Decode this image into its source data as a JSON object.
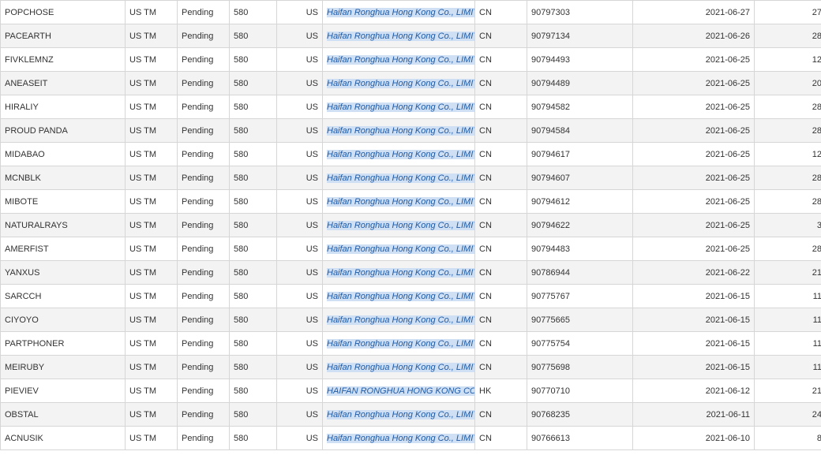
{
  "rows": [
    {
      "name": "POPCHOSE",
      "office": "US TM",
      "status": "Pending",
      "code": "580",
      "country": "US",
      "owner": "Haifan Ronghua Hong Kong Co., LIMITED",
      "owner_country": "CN",
      "serial": "90797303",
      "date": "2021-06-27",
      "count": "27"
    },
    {
      "name": "PACEARTH",
      "office": "US TM",
      "status": "Pending",
      "code": "580",
      "country": "US",
      "owner": "Haifan Ronghua Hong Kong Co., LIMITED",
      "owner_country": "CN",
      "serial": "90797134",
      "date": "2021-06-26",
      "count": "28"
    },
    {
      "name": "FIVKLEMNZ",
      "office": "US TM",
      "status": "Pending",
      "code": "580",
      "country": "US",
      "owner": "Haifan Ronghua Hong Kong Co., LIMITED",
      "owner_country": "CN",
      "serial": "90794493",
      "date": "2021-06-25",
      "count": "12"
    },
    {
      "name": "ANEASEIT",
      "office": "US TM",
      "status": "Pending",
      "code": "580",
      "country": "US",
      "owner": "Haifan Ronghua Hong Kong Co., LIMITED",
      "owner_country": "CN",
      "serial": "90794489",
      "date": "2021-06-25",
      "count": "20"
    },
    {
      "name": "HIRALIY",
      "office": "US TM",
      "status": "Pending",
      "code": "580",
      "country": "US",
      "owner": "Haifan Ronghua Hong Kong Co., LIMITED",
      "owner_country": "CN",
      "serial": "90794582",
      "date": "2021-06-25",
      "count": "28"
    },
    {
      "name": "PROUD PANDA",
      "office": "US TM",
      "status": "Pending",
      "code": "580",
      "country": "US",
      "owner": "Haifan Ronghua Hong Kong Co., LIMITED",
      "owner_country": "CN",
      "serial": "90794584",
      "date": "2021-06-25",
      "count": "28"
    },
    {
      "name": "MIDABAO",
      "office": "US TM",
      "status": "Pending",
      "code": "580",
      "country": "US",
      "owner": "Haifan Ronghua Hong Kong Co., LIMITED",
      "owner_country": "CN",
      "serial": "90794617",
      "date": "2021-06-25",
      "count": "12"
    },
    {
      "name": "MCNBLK",
      "office": "US TM",
      "status": "Pending",
      "code": "580",
      "country": "US",
      "owner": "Haifan Ronghua Hong Kong Co., LIMITED",
      "owner_country": "CN",
      "serial": "90794607",
      "date": "2021-06-25",
      "count": "28"
    },
    {
      "name": "MIBOTE",
      "office": "US TM",
      "status": "Pending",
      "code": "580",
      "country": "US",
      "owner": "Haifan Ronghua Hong Kong Co., LIMITED",
      "owner_country": "CN",
      "serial": "90794612",
      "date": "2021-06-25",
      "count": "28"
    },
    {
      "name": "NATURALRAYS",
      "office": "US TM",
      "status": "Pending",
      "code": "580",
      "country": "US",
      "owner": "Haifan Ronghua Hong Kong Co., LIMITED",
      "owner_country": "CN",
      "serial": "90794622",
      "date": "2021-06-25",
      "count": "3"
    },
    {
      "name": "AMERFIST",
      "office": "US TM",
      "status": "Pending",
      "code": "580",
      "country": "US",
      "owner": "Haifan Ronghua Hong Kong Co., LIMITED",
      "owner_country": "CN",
      "serial": "90794483",
      "date": "2021-06-25",
      "count": "28"
    },
    {
      "name": "YANXUS",
      "office": "US TM",
      "status": "Pending",
      "code": "580",
      "country": "US",
      "owner": "Haifan Ronghua Hong Kong Co., LIMITED",
      "owner_country": "CN",
      "serial": "90786944",
      "date": "2021-06-22",
      "count": "21"
    },
    {
      "name": "SARCCH",
      "office": "US TM",
      "status": "Pending",
      "code": "580",
      "country": "US",
      "owner": "Haifan Ronghua Hong Kong Co., LIMITED",
      "owner_country": "CN",
      "serial": "90775767",
      "date": "2021-06-15",
      "count": "11"
    },
    {
      "name": "CIYOYO",
      "office": "US TM",
      "status": "Pending",
      "code": "580",
      "country": "US",
      "owner": "Haifan Ronghua Hong Kong Co., LIMITED",
      "owner_country": "CN",
      "serial": "90775665",
      "date": "2021-06-15",
      "count": "11"
    },
    {
      "name": "PARTPHONER",
      "office": "US TM",
      "status": "Pending",
      "code": "580",
      "country": "US",
      "owner": "Haifan Ronghua Hong Kong Co., LIMITED",
      "owner_country": "CN",
      "serial": "90775754",
      "date": "2021-06-15",
      "count": "11"
    },
    {
      "name": "MEIRUBY",
      "office": "US TM",
      "status": "Pending",
      "code": "580",
      "country": "US",
      "owner": "Haifan Ronghua Hong Kong Co., LIMITED",
      "owner_country": "CN",
      "serial": "90775698",
      "date": "2021-06-15",
      "count": "11"
    },
    {
      "name": "PIEVIEV",
      "office": "US TM",
      "status": "Pending",
      "code": "580",
      "country": "US",
      "owner": "HAIFAN RONGHUA HONG KONG CO. LIMITED",
      "owner_country": "HK",
      "serial": "90770710",
      "date": "2021-06-12",
      "count": "21"
    },
    {
      "name": "OBSTAL",
      "office": "US TM",
      "status": "Pending",
      "code": "580",
      "country": "US",
      "owner": "Haifan Ronghua Hong Kong Co., LIMITED",
      "owner_country": "CN",
      "serial": "90768235",
      "date": "2021-06-11",
      "count": "24"
    },
    {
      "name": "ACNUSIK",
      "office": "US TM",
      "status": "Pending",
      "code": "580",
      "country": "US",
      "owner": "Haifan Ronghua Hong Kong Co., LIMITED",
      "owner_country": "CN",
      "serial": "90766613",
      "date": "2021-06-10",
      "count": "8"
    }
  ]
}
